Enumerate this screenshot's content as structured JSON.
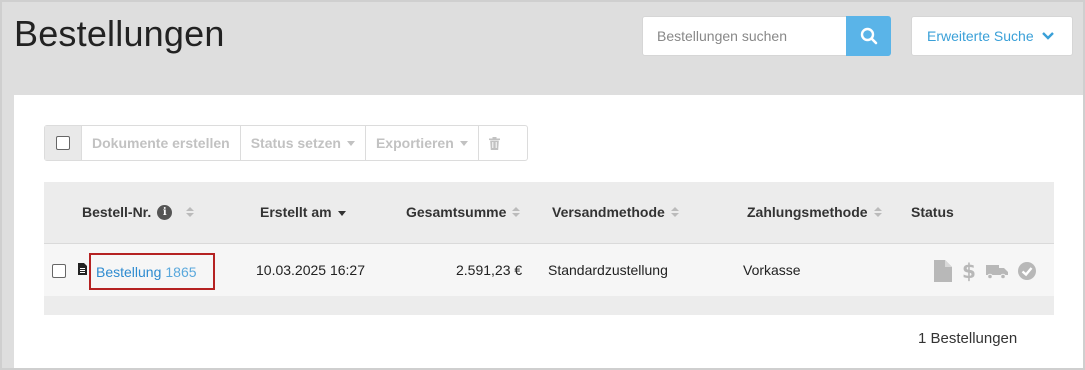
{
  "header": {
    "title": "Bestellungen",
    "search_placeholder": "Bestellungen suchen",
    "advanced_search_label": "Erweiterte Suche"
  },
  "toolbar": {
    "create_docs_label": "Dokumente erstellen",
    "set_status_label": "Status setzen",
    "export_label": "Exportieren"
  },
  "table": {
    "columns": {
      "order_no": "Bestell-Nr.",
      "created": "Erstellt am",
      "total": "Gesamtsumme",
      "shipping": "Versandmethode",
      "payment": "Zahlungsmethode",
      "status": "Status"
    },
    "rows": [
      {
        "order_label": "Bestellung",
        "order_number": "1865",
        "created": "10.03.2025 16:27",
        "total": "2.591,23 €",
        "shipping": "Standardzustellung",
        "payment": "Vorkasse",
        "status_icons": [
          "document-icon",
          "dollar-icon",
          "truck-icon",
          "check-circle-icon"
        ]
      }
    ]
  },
  "footer": {
    "count_label": "1 Bestellungen"
  },
  "colors": {
    "accent": "#5ab4e8",
    "link": "#2e8bd0",
    "highlight": "#b52222"
  }
}
